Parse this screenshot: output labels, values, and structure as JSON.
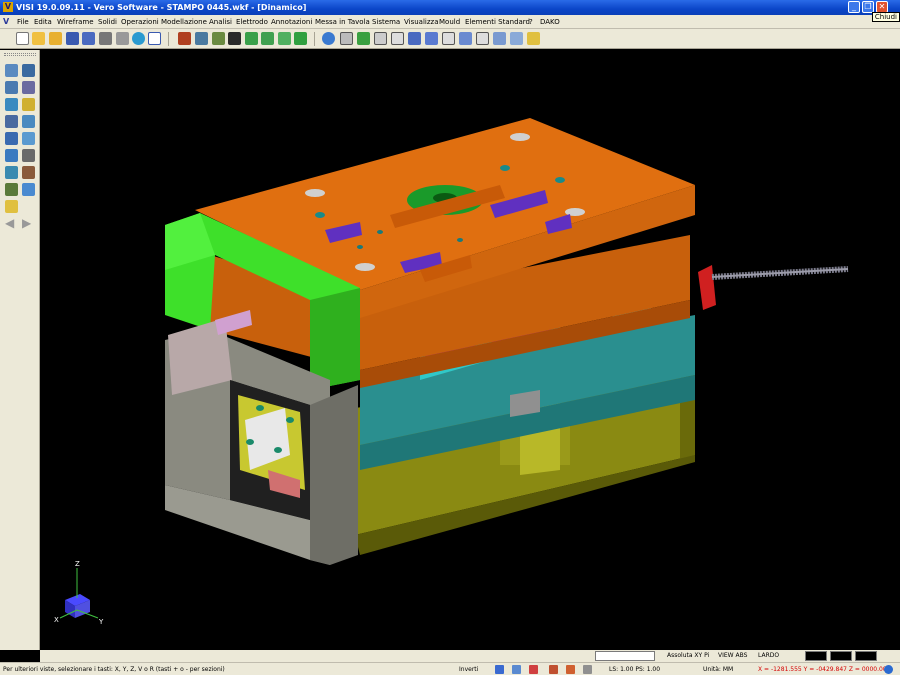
{
  "window": {
    "title": "VISI 19.0.09.11 - Vero Software - STAMPO 0445.wkf - [Dinamico]",
    "tooltip": "Chiudi",
    "minimize_glyph": "_",
    "maximize_glyph": "❐",
    "close_glyph": "✕"
  },
  "menu": {
    "items": [
      "File",
      "Edita",
      "Wireframe",
      "Solidi",
      "Operazioni",
      "Modellazione",
      "Analisi",
      "Elettrodo",
      "Annotazioni",
      "Messa in Tavola",
      "Sistema",
      "Visualizza",
      "Mould",
      "Elementi Standard",
      "?",
      "DAKO"
    ]
  },
  "toolbar": {
    "icons": [
      "new-file-icon",
      "open-folder-icon",
      "open-icon",
      "save-icon",
      "save-as-icon",
      "print-icon",
      "print-preview-icon",
      "globe-icon",
      "window-icon",
      "undo-icon",
      "tool-a-icon",
      "tool-b-icon",
      "tool-c-icon",
      "tool-d-icon",
      "tool-e-icon",
      "tool-f-icon",
      "tool-g-icon",
      "refresh-icon",
      "view-a-icon",
      "view-b-icon",
      "view-c-icon",
      "view-d-icon",
      "view-e-icon",
      "view-f-icon",
      "view-g-icon",
      "view-h-icon",
      "view-i-icon",
      "grid-icon"
    ]
  },
  "left_toolbox": {
    "icons": [
      "zoom-window-icon",
      "zoom-extents-icon",
      "zoom-in-icon",
      "zoom-out-icon",
      "pan-icon",
      "rotate-icon",
      "view-front-icon",
      "view-top-icon",
      "shade-icon",
      "wire-icon",
      "layer-icon",
      "measure-icon",
      "help-icon",
      "back-arrow-icon",
      "forward-arrow-icon"
    ]
  },
  "axes": {
    "x": "X",
    "y": "Y",
    "z": "Z"
  },
  "fieldbar": {
    "coord_mode": "Assoluta XY Pi",
    "view": "VIEW ABS",
    "layer": "LARDO"
  },
  "status": {
    "prompt": "Per ulteriori viste, selezionare i tasti: X, Y, Z, V o R (tasti + o - per sezioni)",
    "invert": "Inverti",
    "ls_ps": "LS: 1.00 PS: 1.00",
    "units": "Unità: MM",
    "coords": "X = -1281.555 Y = -0429.847 Z = 0000.000"
  },
  "colors": {
    "titlebar": "#0b46c8",
    "chrome": "#ece9d8",
    "viewport_bg": "#000000",
    "orange_plate": "#e06f10",
    "teal_plate": "#2a8f8f",
    "olive_plate": "#8a8a12",
    "green_frame": "#3ee02a",
    "gray_frame": "#8a8a80",
    "magenta_part": "#c020c0"
  }
}
